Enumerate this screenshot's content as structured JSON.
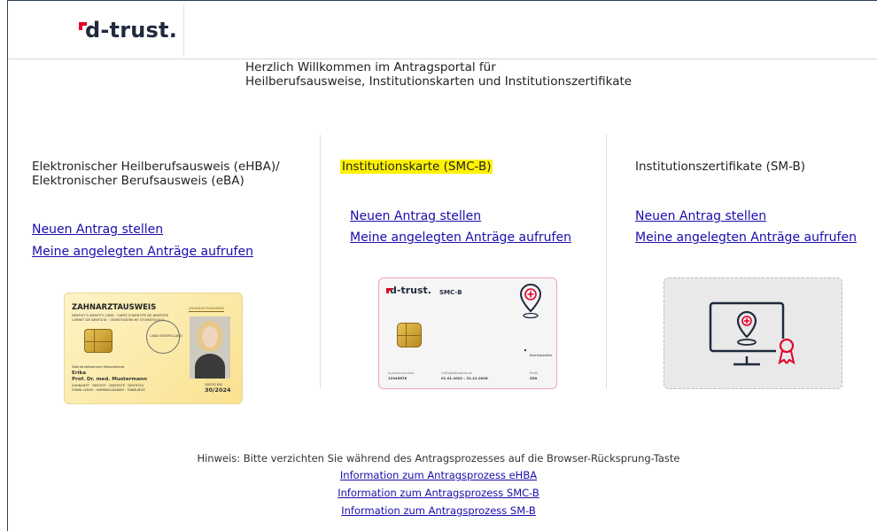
{
  "header": {
    "logo_text": "d-trust."
  },
  "welcome": {
    "line1": "Herzlich Willkommen im Antragsportal für",
    "line2": "Heilberufsausweise, Institutionskarten und Institutionszertifikate"
  },
  "columns": [
    {
      "title_line1": "Elektronischer Heilberufsausweis (eHBA)/",
      "title_line2": "Elektronischer Berufsausweis (eBA)",
      "new_link": "Neuen Antrag stellen",
      "my_link": "Meine angelegten Anträge aufrufen",
      "card": {
        "heading": "ZAHNARZTAUSWEIS",
        "sub1": "DENTIST'S IDENTITY CARD · CARTE D'IDENTITÉ DE DENTISTE",
        "sub2": "CARNET DE DENTISTA · ODONTOIATRICHE STOMATOLOGA",
        "badge": "ZAHNÄRZTEKAMMER",
        "seal": "LAND BEISPIELLAND",
        "chamber": "Zahnärztekammer Beispielland",
        "given": "Erika",
        "name": "Prof. Dr. med. Mustermann",
        "fine1": "ZAHNARZT · DENTIST · DENTISTE · DENTISTA",
        "fine2": "ZUBNI LEKAR · HAMMASLÄÄKÄRI · TANDLÆGE",
        "date_label": "GÜLTIG BIS",
        "date": "30/2024"
      }
    },
    {
      "title": "Institutionskarte (SMC-B)",
      "new_link": "Neuen Antrag stellen",
      "my_link": "Meine angelegten Anträge aufrufen",
      "card": {
        "brand": "d-trust.",
        "type": "SMC-B",
        "side_label": "Betriebsstätte",
        "f1_label": "Ausweisnummer",
        "f1_value": "12345678",
        "f2_label": "Gültigkeitszeitraum",
        "f2_value": "01.01.2022 – 31.12.2026",
        "f3_label": "Profil",
        "f3_value": "ZZA"
      }
    },
    {
      "title": "Institutionszertifikate (SM-B)",
      "new_link": "Neuen Antrag stellen",
      "my_link": "Meine angelegten Anträge aufrufen"
    }
  ],
  "footer": {
    "note": "Hinweis: Bitte verzichten Sie während des Antragsprozesses auf die Browser-Rücksprung-Taste",
    "links": [
      "Information zum Antragsprozess eHBA",
      "Information zum Antragsprozess SMC-B",
      "Information zum Antragsprozess SM-B"
    ]
  },
  "colors": {
    "brand_red": "#e4002b",
    "brand_dark": "#1f2a3c",
    "link": "#1a0dab",
    "highlight": "#fff200"
  }
}
